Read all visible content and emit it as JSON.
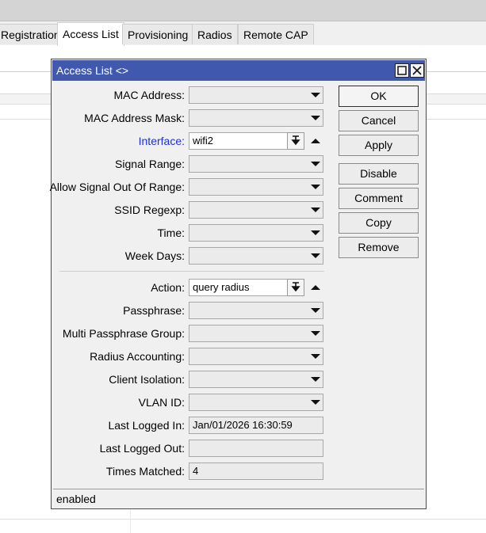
{
  "tabs": [
    "Registration",
    "Access List",
    "Provisioning",
    "Radios",
    "Remote CAP"
  ],
  "active_tab": "Access List",
  "dialog": {
    "title": "Access List <>",
    "fields": {
      "mac_address": {
        "label": "MAC Address:",
        "value": ""
      },
      "mac_address_mask": {
        "label": "MAC Address Mask:",
        "value": ""
      },
      "interface": {
        "label": "Interface:",
        "value": "wifi2"
      },
      "signal_range": {
        "label": "Signal Range:",
        "value": ""
      },
      "allow_signal_out_of_range": {
        "label": "Allow Signal Out Of Range:",
        "value": ""
      },
      "ssid_regexp": {
        "label": "SSID Regexp:",
        "value": ""
      },
      "time": {
        "label": "Time:",
        "value": ""
      },
      "week_days": {
        "label": "Week Days:",
        "value": ""
      },
      "action": {
        "label": "Action:",
        "value": "query radius"
      },
      "passphrase": {
        "label": "Passphrase:",
        "value": ""
      },
      "multi_passphrase_group": {
        "label": "Multi Passphrase Group:",
        "value": ""
      },
      "radius_accounting": {
        "label": "Radius Accounting:",
        "value": ""
      },
      "client_isolation": {
        "label": "Client Isolation:",
        "value": ""
      },
      "vlan_id": {
        "label": "VLAN ID:",
        "value": ""
      },
      "last_logged_in": {
        "label": "Last Logged In:",
        "value": "Jan/01/2026 16:30:59"
      },
      "last_logged_out": {
        "label": "Last Logged Out:",
        "value": ""
      },
      "times_matched": {
        "label": "Times Matched:",
        "value": "4"
      }
    },
    "buttons": {
      "ok": "OK",
      "cancel": "Cancel",
      "apply": "Apply",
      "disable": "Disable",
      "comment": "Comment",
      "copy": "Copy",
      "remove": "Remove"
    },
    "status": "enabled"
  },
  "colors": {
    "titlebar": "#4059ae",
    "link_label": "#1e30d8"
  },
  "icons": [
    "restore-icon",
    "close-icon",
    "dropdown-arrow-icon",
    "collapse-arrow-icon"
  ]
}
